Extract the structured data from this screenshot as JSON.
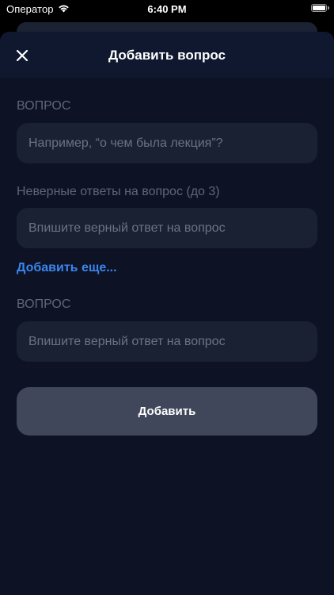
{
  "status_bar": {
    "carrier": "Оператор",
    "time": "6:40 PM",
    "battery_level": 1.0
  },
  "nav": {
    "title": "Добавить вопрос",
    "close_icon": "close-icon"
  },
  "form": {
    "question_label": "ВОПРОС",
    "question_placeholder": "Например, “о чем была лекция”?",
    "wrong_answers_label": "Неверные ответы на вопрос (до 3)",
    "wrong_answer_placeholder": "Впишите верный ответ на вопрос",
    "add_more_label": "Добавить еще...",
    "second_question_label": "ВОПРОС",
    "correct_answer_placeholder": "Впишите верный ответ на вопрос",
    "submit_label": "Добавить"
  },
  "colors": {
    "background": "#0d1224",
    "field": "#1a2132",
    "accent": "#3a86ef",
    "button": "#40475a"
  }
}
